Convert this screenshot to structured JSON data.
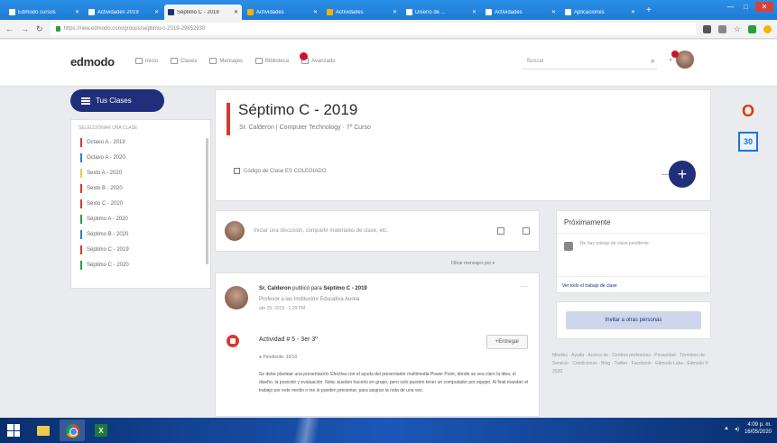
{
  "browser": {
    "tabs": [
      {
        "label": "Edmodo cursos",
        "fav": "#ffffff",
        "active": false
      },
      {
        "label": "Actividades 2019",
        "fav": "#ffffff",
        "active": false
      },
      {
        "label": "Séptimo C - 2019",
        "fav": "#1f2f7a",
        "active": true
      },
      {
        "label": "Actividades",
        "fav": "#f4b400",
        "active": false
      },
      {
        "label": "Actividades",
        "fav": "#f4b400",
        "active": false
      },
      {
        "label": "Diseño de ...",
        "fav": "#ffffff",
        "active": false
      },
      {
        "label": "Actividades",
        "fav": "#ffffff",
        "active": false
      },
      {
        "label": "Aplicaciones",
        "fav": "#ffffff",
        "active": false
      }
    ],
    "new_tab": "+",
    "url": "https://new.edmodo.com/groups/septimo-c-2019-29852930"
  },
  "header": {
    "logo": "edmodo",
    "nav": [
      {
        "label": "Inicio"
      },
      {
        "label": "Clases"
      },
      {
        "label": "Mensajes"
      },
      {
        "label": "Biblioteca"
      },
      {
        "label": "Avanzado"
      }
    ],
    "search_placeholder": "Buscar"
  },
  "sidebar": {
    "button_label": "Tus Clases",
    "list_header": "Seleccionar una clase",
    "classes": [
      {
        "label": "Octavo A - 2019",
        "color": "#d6392e"
      },
      {
        "label": "Octavo A - 2020",
        "color": "#2e7bd6"
      },
      {
        "label": "Sexto A - 2020",
        "color": "#f4c542"
      },
      {
        "label": "Sexto B - 2020",
        "color": "#d6392e"
      },
      {
        "label": "Sexto C - 2020",
        "color": "#d6392e"
      },
      {
        "label": "Séptimo A - 2020",
        "color": "#2a9d3a"
      },
      {
        "label": "Séptimo B - 2020",
        "color": "#2e7bd6"
      },
      {
        "label": "Séptimo C - 2019",
        "color": "#d6392e"
      },
      {
        "label": "Séptimo C - 2020",
        "color": "#2a9d3a"
      }
    ]
  },
  "class": {
    "title": "Séptimo C - 2019",
    "subtitle": "Sr. Calderon | Computer Technology · 7º Curso",
    "code": "Código de Clase ES COLEGIADO"
  },
  "composer": {
    "placeholder": "Iniciar una discusión, compartir materiales de clase, etc.",
    "filter": "Filtrar mensajes por ▾"
  },
  "post": {
    "author": "Sr. Calderon",
    "action": "publicó para",
    "target": "Séptimo C - 2019",
    "org": "Profesor a las Institución Educativa Aurea",
    "date": "abr 29, 2019 · 1:29 PM",
    "more": "···",
    "assignment_title": "Actividad # 5 - 3er 3º",
    "turn_in": "+Entregar",
    "status": "● Pendiente: 10/10",
    "description": "Se debe plantear una presentación Efectiva con el ayuda del presentador multimedia Power Point, donde se vea claro la idea, el diseño, la posición y evaluación. Nota: pueden hacerlo en grupo, pero solo pueden tener un computador por equipo. Al final mandan el trabajo por este medio o me lo pueden presentar, para asignar la nota de una vez."
  },
  "upcoming": {
    "title": "Próximamente",
    "empty": "No hay trabajo de clase pendiente",
    "link": "Ver todo el trabajo de clase"
  },
  "invite_label": "Invitar a otras personas",
  "footer": "Móviles · Ayuda · Acerca de · Centros profesores · Privacidad · Términos de Servicio · Condiciones · Blog · Twitter · Facebook · Edmodo Labs · Edmodo © 2020",
  "apps": {
    "office": "O",
    "calendar": "30"
  },
  "taskbar": {
    "excel": "X",
    "time": "4:09 p. m.",
    "date": "16/05/2020"
  }
}
